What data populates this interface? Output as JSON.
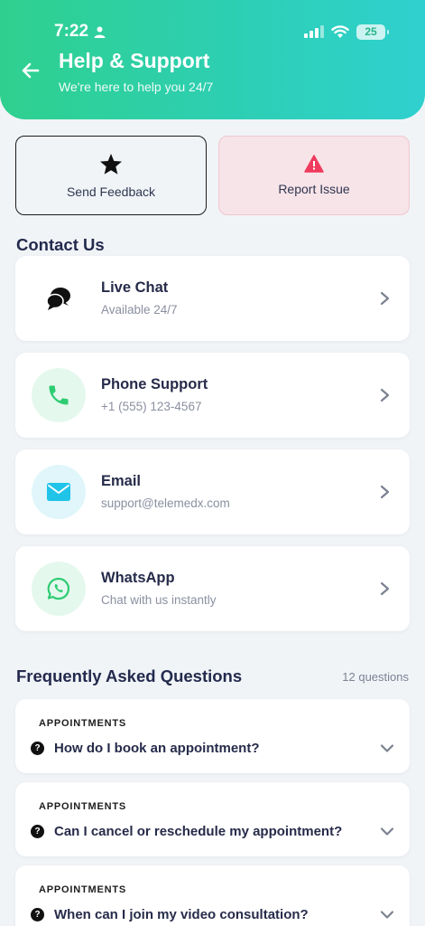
{
  "status": {
    "time": "7:22",
    "battery": "25"
  },
  "header": {
    "title": "Help & Support",
    "subtitle": "We're here to help you 24/7"
  },
  "actions": [
    {
      "label": "Send Feedback",
      "icon": "star-icon"
    },
    {
      "label": "Report Issue",
      "icon": "warning-icon"
    }
  ],
  "contact": {
    "title": "Contact Us",
    "items": [
      {
        "title": "Live Chat",
        "subtitle": "Available 24/7",
        "icon": "chat-bubbles-icon"
      },
      {
        "title": "Phone Support",
        "subtitle": "+1 (555) 123-4567",
        "icon": "phone-icon"
      },
      {
        "title": "Email",
        "subtitle": "support@telemedx.com",
        "icon": "mail-icon"
      },
      {
        "title": "WhatsApp",
        "subtitle": "Chat with us instantly",
        "icon": "whatsapp-icon"
      }
    ]
  },
  "faq": {
    "title": "Frequently Asked Questions",
    "count": "12 questions",
    "items": [
      {
        "category": "APPOINTMENTS",
        "question": "How do I book an appointment?"
      },
      {
        "category": "APPOINTMENTS",
        "question": "Can I cancel or reschedule my appointment?"
      },
      {
        "category": "APPOINTMENTS",
        "question": "When can I join my video consultation?"
      }
    ]
  },
  "colors": {
    "header_start": "#2fd08e",
    "header_end": "#2fd0cf",
    "phone_bg": "#e4f8ee",
    "phone_fg": "#2ecc71",
    "email_bg": "#e0f6fb",
    "email_fg": "#20c4e8",
    "whatsapp_bg": "#e4f8ee",
    "whatsapp_fg": "#2ecc71",
    "warning": "#ef3b5d"
  }
}
